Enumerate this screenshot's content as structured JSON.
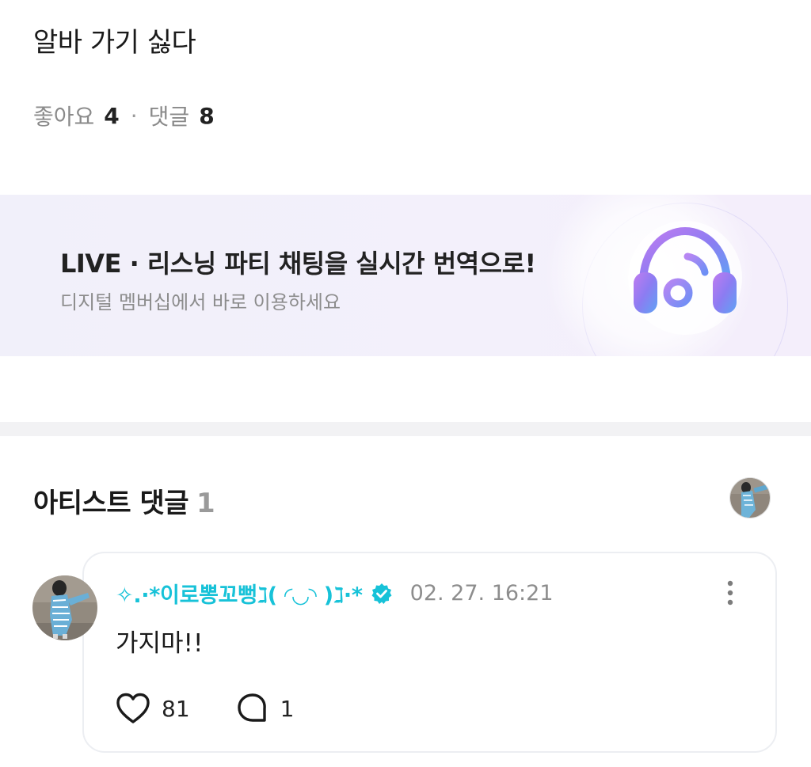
{
  "post": {
    "text": "알바 가기 싫다",
    "likes_label": "좋아요",
    "likes_count": "4",
    "separator": "·",
    "comments_label": "댓글",
    "comments_count": "8"
  },
  "banner": {
    "title": "LIVE · 리스닝 파티 채팅을 실시간 번역으로!",
    "subtitle": "디지털 멤버십에서 바로 이용하세요",
    "icon": "headphone-music-icon"
  },
  "artist_comments": {
    "title": "아티스트 댓글",
    "count": "1"
  },
  "comment": {
    "author": "✧.·*이로뽕꼬뻥ℷ( ◜◡◝ )ℷ·*",
    "verified_icon": "verified-badge-icon",
    "date": "02. 27. 16:21",
    "text": "가지마!!",
    "likes": "81",
    "replies": "1"
  },
  "colors": {
    "accent": "#17c2d8",
    "banner_bg": "#f2f0fa",
    "divider": "#f2f2f4"
  }
}
